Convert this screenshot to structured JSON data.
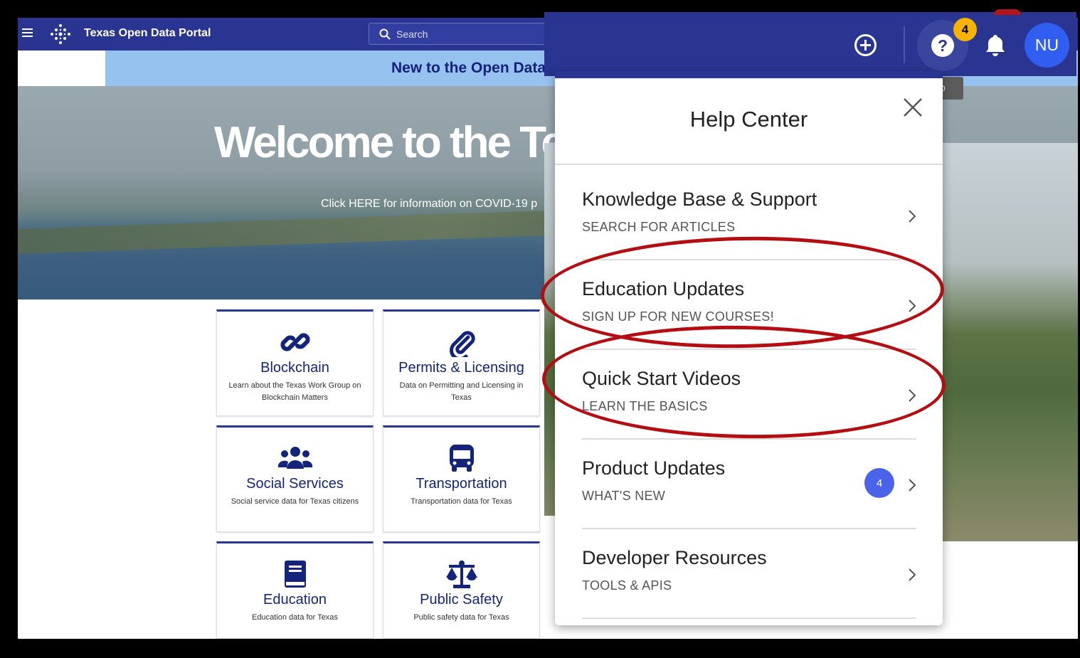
{
  "portal": {
    "site_title": "Texas Open Data Portal",
    "search_placeholder": "Search",
    "banner_text": "New to the Open Data",
    "hero_title": "Welcome to the Tex",
    "hero_covid": "Click HERE for information on COVID-19 p"
  },
  "cards": [
    {
      "title": "Blockchain",
      "desc": "Learn about the Texas Work Group on Blockchain Matters",
      "icon": "link-icon"
    },
    {
      "title": "Permits & Licensing",
      "desc": "Data on Permitting and Licensing in Texas",
      "icon": "paperclip-icon"
    },
    {
      "title": "Social Services",
      "desc": "Social service data for Texas citizens",
      "icon": "people-icon"
    },
    {
      "title": "Transportation",
      "desc": "Transportation data for Texas",
      "icon": "bus-icon"
    },
    {
      "title": "Education",
      "desc": "Education data for Texas",
      "icon": "book-icon"
    },
    {
      "title": "Public Safety",
      "desc": "Public safety data for Texas",
      "icon": "scales-icon"
    }
  ],
  "appbar": {
    "help_badge": "4",
    "avatar_initials": "NU",
    "tooltip": "lp"
  },
  "help_center": {
    "title": "Help Center",
    "items": [
      {
        "title": "Knowledge Base & Support",
        "subtitle": "SEARCH FOR ARTICLES"
      },
      {
        "title": "Education Updates",
        "subtitle": "SIGN UP FOR NEW COURSES!"
      },
      {
        "title": "Quick Start Videos",
        "subtitle": "LEARN THE BASICS"
      },
      {
        "title": "Product Updates",
        "subtitle": "WHAT'S NEW",
        "count": "4"
      },
      {
        "title": "Developer Resources",
        "subtitle": "TOOLS & APIS"
      }
    ]
  },
  "colors": {
    "brand_navy": "#2a3591",
    "banner_blue": "#96c2f0",
    "badge_yellow": "#f5b400",
    "avatar_blue": "#2f5ef0",
    "annotation_red": "#b40d12"
  }
}
